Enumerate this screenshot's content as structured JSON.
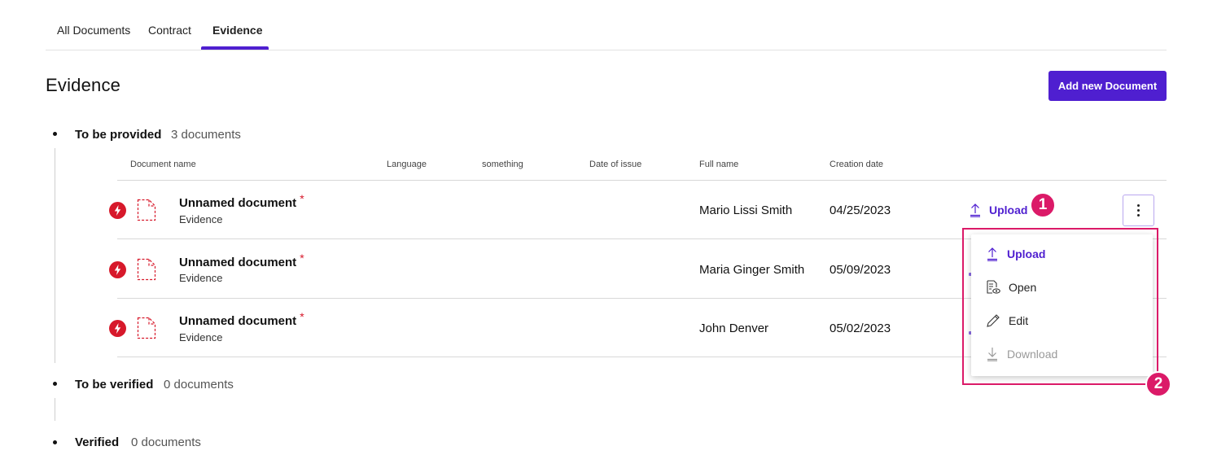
{
  "tabs": [
    {
      "label": "All Documents",
      "active": false
    },
    {
      "label": "Contract",
      "active": false
    },
    {
      "label": "Evidence",
      "active": true
    }
  ],
  "page_title": "Evidence",
  "add_button_label": "Add new Document",
  "sections": [
    {
      "title": "To be provided",
      "count": "3 documents"
    },
    {
      "title": "To be verified",
      "count": "0 documents"
    },
    {
      "title": "Verified",
      "count": "0 documents"
    }
  ],
  "table": {
    "columns": [
      "Document name",
      "Language",
      "something",
      "Date of issue",
      "Full name",
      "Creation date"
    ],
    "rows": [
      {
        "name": "Unnamed document",
        "required": "*",
        "type": "Evidence",
        "full_name": "Mario Lissi Smith",
        "creation_date": "04/25/2023"
      },
      {
        "name": "Unnamed document",
        "required": "*",
        "type": "Evidence",
        "full_name": "Maria Ginger Smith",
        "creation_date": "05/09/2023"
      },
      {
        "name": "Unnamed document",
        "required": "*",
        "type": "Evidence",
        "full_name": "John Denver",
        "creation_date": "05/02/2023"
      }
    ]
  },
  "row_action": {
    "upload_label": "Upload"
  },
  "annotations": [
    "1",
    "2"
  ],
  "menu": {
    "items": [
      {
        "label": "Upload",
        "icon": "upload-icon",
        "state": "primary"
      },
      {
        "label": "Open",
        "icon": "open-document-icon",
        "state": "normal"
      },
      {
        "label": "Edit",
        "icon": "pencil-icon",
        "state": "normal"
      },
      {
        "label": "Download",
        "icon": "download-icon",
        "state": "disabled"
      }
    ]
  },
  "colors": {
    "accent": "#4f1fd0",
    "error": "#d7192b",
    "annotation": "#db1a68"
  }
}
